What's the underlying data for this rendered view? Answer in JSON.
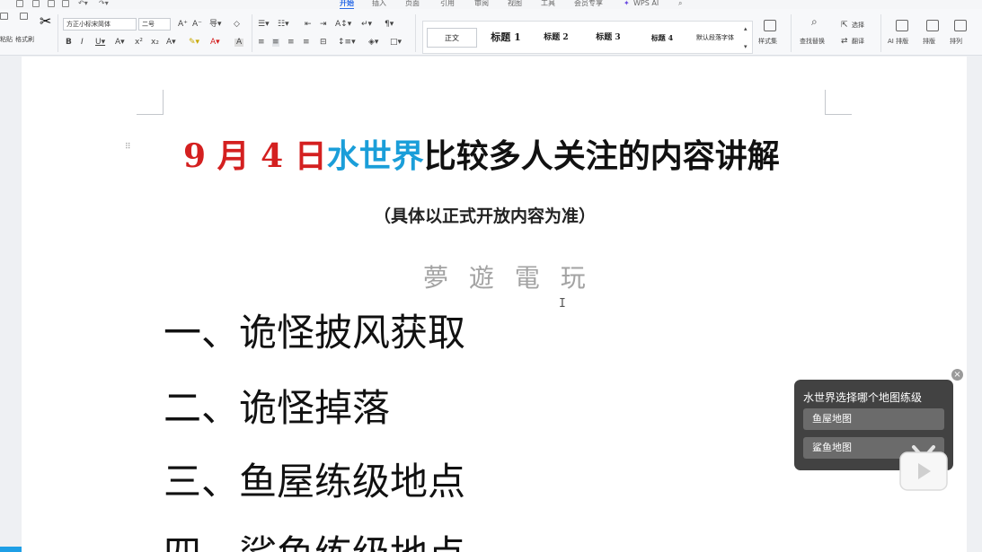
{
  "menu_tabs": [
    {
      "label": "开始",
      "active": true
    },
    {
      "label": "插入",
      "active": false
    },
    {
      "label": "页面",
      "active": false
    },
    {
      "label": "引用",
      "active": false
    },
    {
      "label": "审阅",
      "active": false
    },
    {
      "label": "视图",
      "active": false
    },
    {
      "label": "工具",
      "active": false
    },
    {
      "label": "会员专享",
      "active": false
    },
    {
      "label": "WPS AI",
      "active": false
    }
  ],
  "ribbon": {
    "paste_label": "粘贴",
    "format_painter_label": "格式刷",
    "font_name": "方正小标宋简体",
    "font_size": "二号",
    "styles": [
      "正文",
      "标题 1",
      "标题 2",
      "标题 3",
      "标题 4",
      "默认段落字体"
    ],
    "style_set_label": "样式集",
    "find_replace_label": "查找替换",
    "select_label": "选择",
    "translate_label": "翻译",
    "ai_layout_label": "AI 排版",
    "layout_label": "排版",
    "arrange_label": "排列"
  },
  "document": {
    "title_part1": "9 月 4 日",
    "title_part2": "水世界",
    "title_part3": "比较多人关注的内容讲解",
    "subtitle": "（具体以正式开放内容为准）",
    "watermark": "夢 遊 電 玩",
    "headings": [
      "一、诡怪披风获取",
      "二、诡怪掉落",
      "三、鱼屋练级地点",
      "四、鲨鱼练级地点"
    ]
  },
  "popup": {
    "question": "水世界选择哪个地图练级",
    "options": [
      "鱼屋地图",
      "鲨鱼地图"
    ]
  },
  "colors": {
    "accent_blue": "#2b6be6",
    "title_red": "#d42020",
    "title_blue": "#1a9ed9"
  }
}
